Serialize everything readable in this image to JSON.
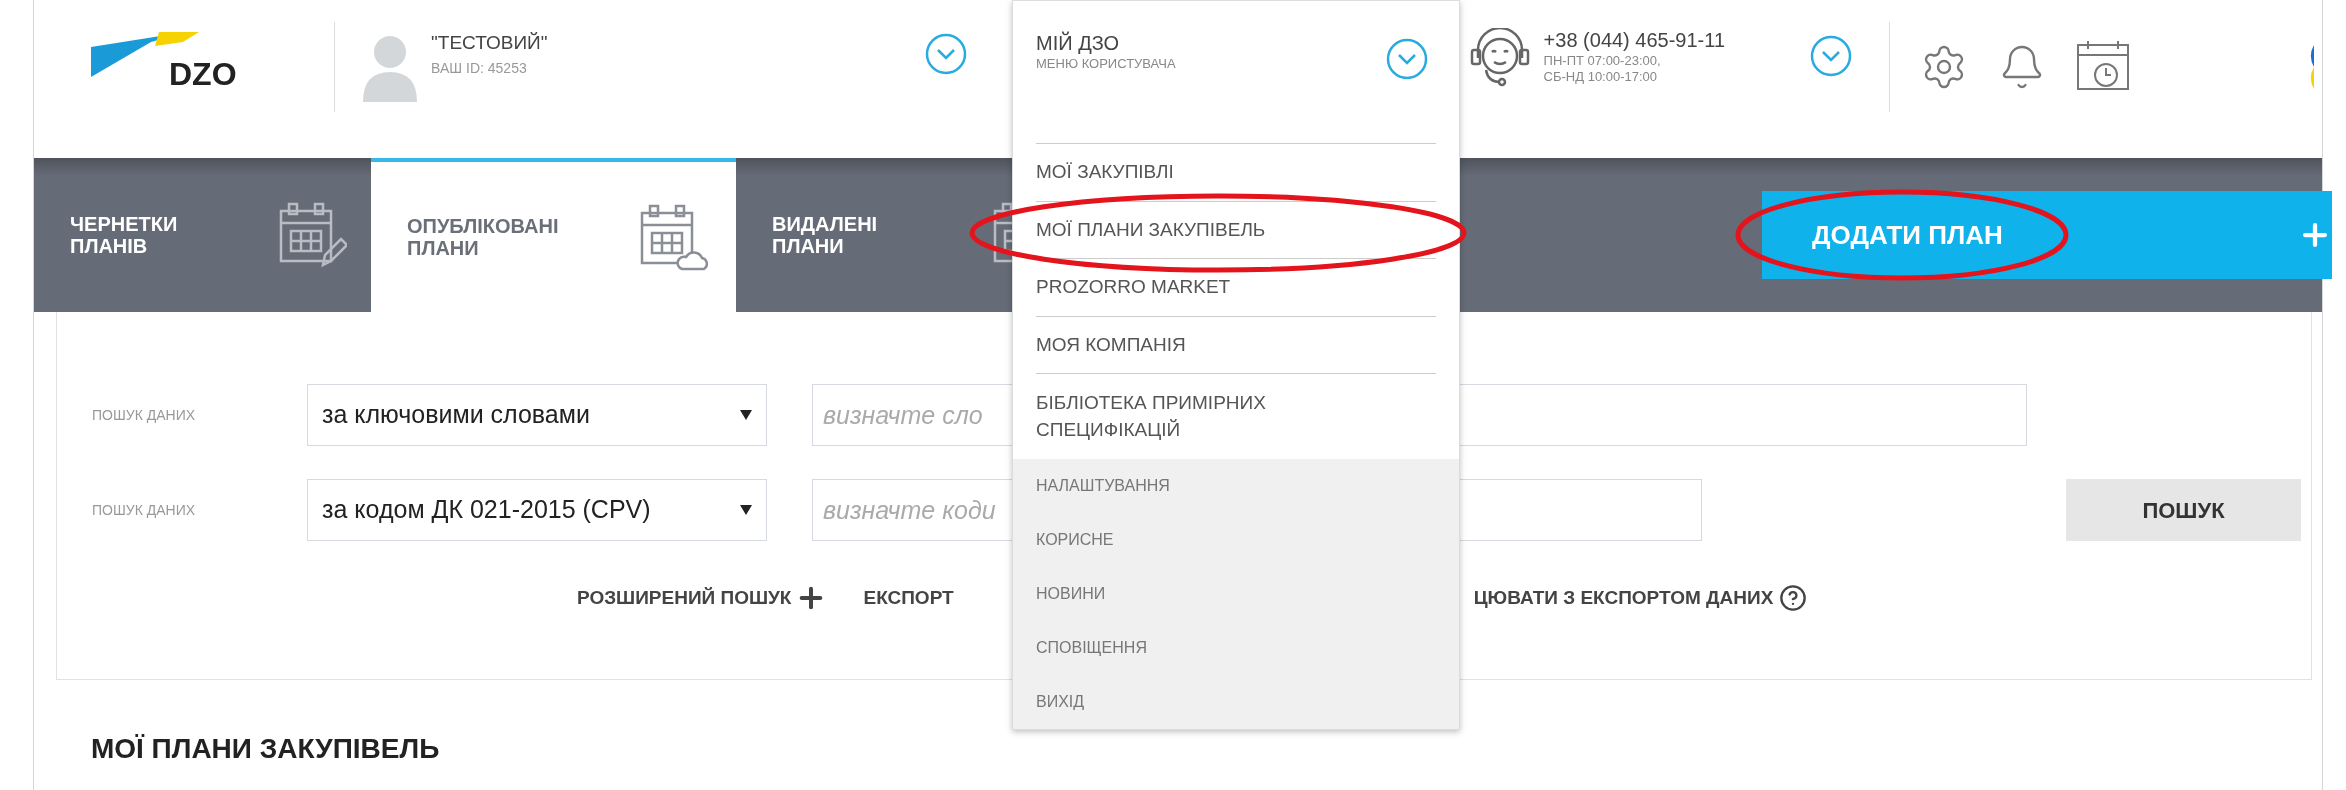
{
  "header": {
    "logo": "DZO",
    "user": {
      "name": "\"ТЕСТОВИЙ\"",
      "id": "ВАШ ID: 45253"
    },
    "support": {
      "phone": "+38 (044) 465-91-11",
      "hours": [
        "ПН-ПТ 07:00-23:00,",
        "СБ-НД 10:00-17:00"
      ]
    }
  },
  "user_menu": {
    "title": "МІЙ ДЗО",
    "subtitle": "МЕНЮ КОРИСТУВАЧА",
    "expanded": true,
    "items": [
      {
        "label": "МОЇ ЗАКУПІВЛІ",
        "kind": "main"
      },
      {
        "label": "МОЇ ПЛАНИ ЗАКУПІВЕЛЬ",
        "kind": "main"
      },
      {
        "label": "PROZORRO MARKET",
        "kind": "main"
      },
      {
        "label": "МОЯ КОМПАНІЯ",
        "kind": "main"
      },
      {
        "label": "БІБЛІОТЕКА ПРИМІРНИХ СПЕЦИФІКАЦІЙ",
        "kind": "main"
      },
      {
        "label": "НАЛАШТУВАННЯ",
        "kind": "secondary"
      },
      {
        "label": "КОРИСНЕ",
        "kind": "secondary"
      },
      {
        "label": "НОВИНИ",
        "kind": "secondary"
      },
      {
        "label": "СПОВІЩЕННЯ",
        "kind": "secondary"
      },
      {
        "label": "ВИХІД",
        "kind": "secondary"
      }
    ]
  },
  "tabs": [
    {
      "label": "ЧЕРНЕТКИ ПЛАНІВ",
      "selected": false
    },
    {
      "label": "ОПУБЛІКОВАНІ ПЛАНИ",
      "selected": true
    },
    {
      "label": "ВИДАЛЕНІ ПЛАНИ",
      "selected": false
    }
  ],
  "add_button": {
    "label": "ДОДАТИ ПЛАН"
  },
  "search": {
    "rows": [
      {
        "label": "ПОШУК ДАНИХ",
        "select": "за ключовими словами",
        "placeholder": "визначте сло"
      },
      {
        "label": "ПОШУК ДАНИХ",
        "select": "за кодом ДК 021-2015 (CPV)",
        "placeholder": "визначте коди"
      }
    ],
    "button": "ПОШУК"
  },
  "links": [
    "РОЗШИРЕНИЙ ПОШУК",
    "ЕКСПОРТ",
    "ЦЮВАТИ З ЕКСПОРТОМ ДАНИХ"
  ],
  "heading": "МОЇ ПЛАНИ ЗАКУПІВЕЛЬ"
}
